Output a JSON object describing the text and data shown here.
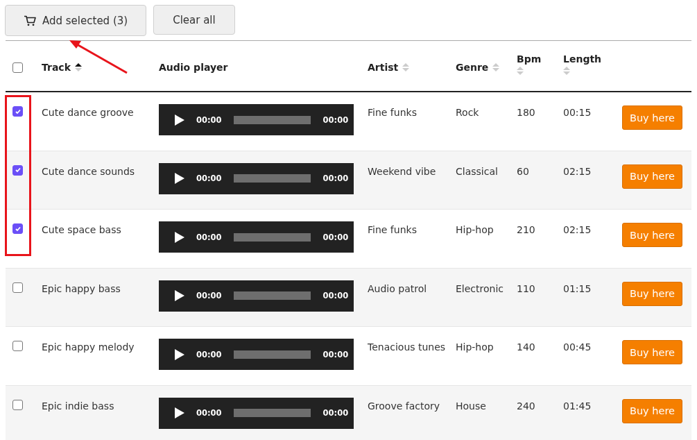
{
  "toolbar": {
    "buttons": [
      {
        "label": "Add selected (3)"
      },
      {
        "label": "Clear all"
      }
    ]
  },
  "table": {
    "header_checked": false,
    "columns": [
      {
        "label": "Track",
        "sortable": true,
        "sorted": true
      },
      {
        "label": "Audio player",
        "sortable": false
      },
      {
        "label": "Artist",
        "sortable": true,
        "sorted": false
      },
      {
        "label": "Genre",
        "sortable": true,
        "sorted": false
      },
      {
        "label": "Bpm",
        "sortable": true,
        "sorted": false
      },
      {
        "label": "Length",
        "sortable": true,
        "sorted": false
      }
    ],
    "rows": [
      {
        "checked": true,
        "track": "Cute dance groove",
        "time_elapsed": "00:00",
        "time_total": "00:00",
        "artist": "Fine funks",
        "genre": "Rock",
        "bpm": "180",
        "length": "00:15",
        "action": "Buy here"
      },
      {
        "checked": true,
        "track": "Cute dance sounds",
        "time_elapsed": "00:00",
        "time_total": "00:00",
        "artist": "Weekend vibe",
        "genre": "Classical",
        "bpm": "60",
        "length": "02:15",
        "action": "Buy here"
      },
      {
        "checked": true,
        "track": "Cute space bass",
        "time_elapsed": "00:00",
        "time_total": "00:00",
        "artist": "Fine funks",
        "genre": "Hip-hop",
        "bpm": "210",
        "length": "02:15",
        "action": "Buy here"
      },
      {
        "checked": false,
        "track": "Epic happy bass",
        "time_elapsed": "00:00",
        "time_total": "00:00",
        "artist": "Audio patrol",
        "genre": "Electronic",
        "bpm": "110",
        "length": "01:15",
        "action": "Buy here"
      },
      {
        "checked": false,
        "track": "Epic happy melody",
        "time_elapsed": "00:00",
        "time_total": "00:00",
        "artist": "Tenacious tunes",
        "genre": "Hip-hop",
        "bpm": "140",
        "length": "00:45",
        "action": "Buy here"
      },
      {
        "checked": false,
        "track": "Epic indie bass",
        "time_elapsed": "00:00",
        "time_total": "00:00",
        "artist": "Groove factory",
        "genre": "House",
        "bpm": "240",
        "length": "01:45",
        "action": "Buy here"
      }
    ]
  }
}
